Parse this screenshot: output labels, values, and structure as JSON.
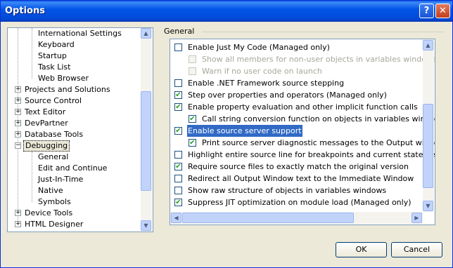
{
  "window": {
    "title": "Options",
    "help_label": "?",
    "close_label": "✕"
  },
  "tree": {
    "items": [
      {
        "label": "International Settings",
        "expander": ""
      },
      {
        "label": "Keyboard",
        "expander": ""
      },
      {
        "label": "Startup",
        "expander": ""
      },
      {
        "label": "Task List",
        "expander": ""
      },
      {
        "label": "Web Browser",
        "expander": ""
      },
      {
        "label": "Projects and Solutions",
        "expander": "+"
      },
      {
        "label": "Source Control",
        "expander": "+"
      },
      {
        "label": "Text Editor",
        "expander": "+"
      },
      {
        "label": "DevPartner",
        "expander": "+"
      },
      {
        "label": "Database Tools",
        "expander": "+"
      },
      {
        "label": "Debugging",
        "expander": "−"
      },
      {
        "label": "General",
        "expander": ""
      },
      {
        "label": "Edit and Continue",
        "expander": ""
      },
      {
        "label": "Just-In-Time",
        "expander": ""
      },
      {
        "label": "Native",
        "expander": ""
      },
      {
        "label": "Symbols",
        "expander": ""
      },
      {
        "label": "Device Tools",
        "expander": "+"
      },
      {
        "label": "HTML Designer",
        "expander": "+"
      }
    ],
    "selected": "Debugging",
    "scroll_up": "▲",
    "scroll_down": "▼"
  },
  "group": {
    "title": "General"
  },
  "options": [
    {
      "label": "Enable Just My Code (Managed only)",
      "checked": "",
      "disabled": false
    },
    {
      "label": "Show all members for non-user objects in variables windows (Visu",
      "checked": "",
      "disabled": true
    },
    {
      "label": "Warn if no user code on launch",
      "checked": "",
      "disabled": true
    },
    {
      "label": "Enable .NET Framework source stepping",
      "checked": "",
      "disabled": false
    },
    {
      "label": "Step over properties and operators (Managed only)",
      "checked": "✔",
      "disabled": false
    },
    {
      "label": "Enable property evaluation and other implicit function calls",
      "checked": "✔",
      "disabled": false
    },
    {
      "label": "Call string conversion function on objects in variables windows (C",
      "checked": "✔",
      "disabled": false
    },
    {
      "label": "Enable source server support",
      "checked": "✔",
      "disabled": false
    },
    {
      "label": "Print source server diagnostic messages to the Output window",
      "checked": "✔",
      "disabled": false
    },
    {
      "label": "Highlight entire source line for breakpoints and current statement",
      "checked": "",
      "disabled": false
    },
    {
      "label": "Require source files to exactly match the original version",
      "checked": "✔",
      "disabled": false
    },
    {
      "label": "Redirect all Output Window text to the Immediate Window",
      "checked": "",
      "disabled": false
    },
    {
      "label": "Show raw structure of objects in variables windows",
      "checked": "",
      "disabled": false
    },
    {
      "label": "Suppress JIT optimization on module load (Managed only)",
      "checked": "✔",
      "disabled": false
    }
  ],
  "panel_scroll": {
    "up": "▲",
    "down": "▼",
    "left": "◀",
    "right": "▶"
  },
  "buttons": {
    "ok": "OK",
    "cancel": "Cancel"
  }
}
